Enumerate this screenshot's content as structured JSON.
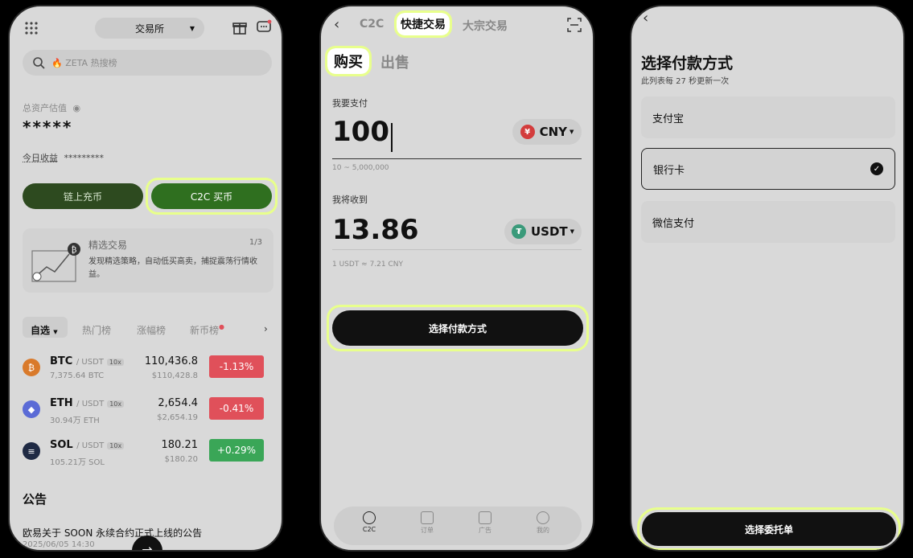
{
  "phone1": {
    "header": {
      "exchange_label": "交易所"
    },
    "search": {
      "placeholder": "🔥 ZETA 热搜榜"
    },
    "assets": {
      "label": "总资产估值",
      "masked_value": "*****",
      "today_label": "今日收益",
      "today_masked": "*********"
    },
    "buttons": {
      "onchain": "链上充币",
      "c2c_buy": "C2C 买币"
    },
    "banner": {
      "title": "精选交易",
      "page": "1/3",
      "text": "发现精选策略，自动低买高卖，捕捉震荡行情收益。"
    },
    "tabs": [
      "自选",
      "热门榜",
      "涨幅榜",
      "新币榜"
    ],
    "coins": [
      {
        "name": "BTC",
        "pair": "/ USDT",
        "lev": "10x",
        "vol": "7,375.64 BTC",
        "price": "110,436.8",
        "fiat": "$110,428.8",
        "change": "-1.13%",
        "color": "#d97a2b",
        "sym": "₿",
        "up": false
      },
      {
        "name": "ETH",
        "pair": "/ USDT",
        "lev": "10x",
        "vol": "30.94万 ETH",
        "price": "2,654.4",
        "fiat": "$2,654.19",
        "change": "-0.41%",
        "color": "#5b6bd6",
        "sym": "◆",
        "up": false
      },
      {
        "name": "SOL",
        "pair": "/ USDT",
        "lev": "10x",
        "vol": "105.21万 SOL",
        "price": "180.21",
        "fiat": "$180.20",
        "change": "+0.29%",
        "color": "#1f2a44",
        "sym": "≡",
        "up": true
      }
    ],
    "notice": {
      "title": "公告",
      "item": "欧易关于 SOON 永续合约正式上线的公告",
      "date": "2025/06/05 14:30"
    }
  },
  "phone2": {
    "nav": {
      "c2c": "C2C",
      "quick": "快捷交易",
      "bulk": "大宗交易"
    },
    "trade_tabs": {
      "buy": "购买",
      "sell": "出售"
    },
    "pay": {
      "label": "我要支付",
      "amount": "100",
      "currency": "CNY",
      "range": "10 ~ 5,000,000"
    },
    "receive": {
      "label": "我将收到",
      "amount": "13.86",
      "currency": "USDT",
      "rate": "1 USDT ≈ 7.21 CNY"
    },
    "action": "选择付款方式",
    "bottom_nav": [
      "C2C",
      "订单",
      "广告",
      "我的"
    ]
  },
  "phone3": {
    "title": "选择付款方式",
    "subtitle": "此列表每 27 秒更新一次",
    "options": [
      "支付宝",
      "银行卡",
      "微信支付"
    ],
    "selected_index": 1,
    "action": "选择委托单"
  },
  "colors": {
    "up": "#3aa657",
    "down": "#e0505a",
    "highlight": "#e8ff8c",
    "c2c_green": "#2f6f1f"
  }
}
